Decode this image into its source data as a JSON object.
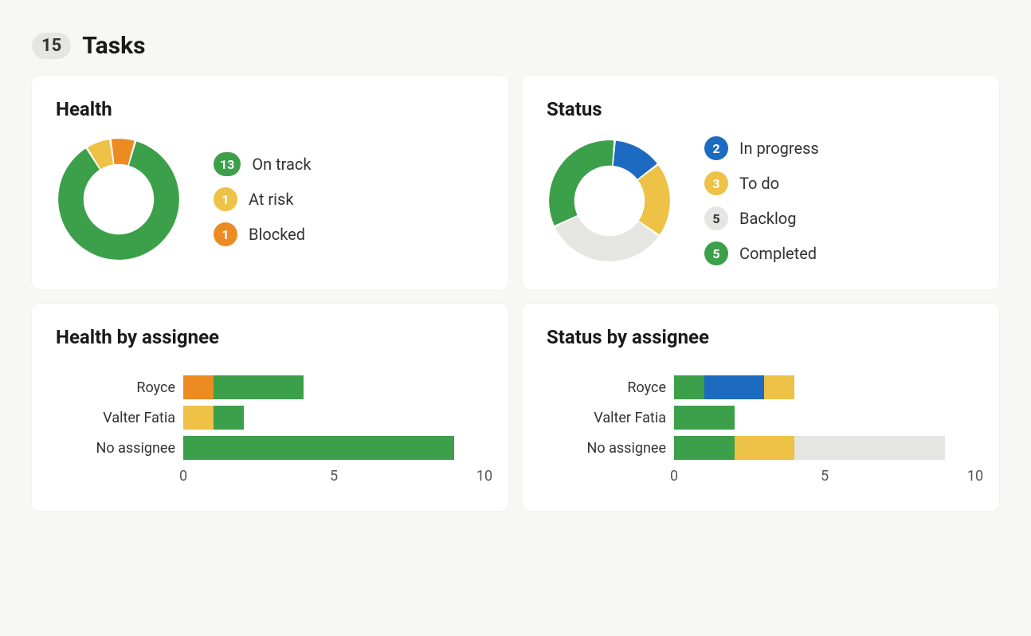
{
  "header": {
    "count": "15",
    "title": "Tasks"
  },
  "colors": {
    "green": "#3c9f4a",
    "yellow": "#eec147",
    "orange": "#ec8b22",
    "blue": "#1d6bc0",
    "grey": "#e5e5e1",
    "dark": "#333333"
  },
  "cards": {
    "health": {
      "title": "Health",
      "items": [
        {
          "value": 13,
          "label": "On track",
          "colorKey": "green"
        },
        {
          "value": 1,
          "label": "At risk",
          "colorKey": "yellow"
        },
        {
          "value": 1,
          "label": "Blocked",
          "colorKey": "orange"
        }
      ]
    },
    "status": {
      "title": "Status",
      "items": [
        {
          "value": 2,
          "label": "In progress",
          "colorKey": "blue"
        },
        {
          "value": 3,
          "label": "To do",
          "colorKey": "yellow"
        },
        {
          "value": 5,
          "label": "Backlog",
          "colorKey": "grey",
          "textColorKey": "dark"
        },
        {
          "value": 5,
          "label": "Completed",
          "colorKey": "green"
        }
      ]
    },
    "health_by_assignee": {
      "title": "Health by assignee",
      "xmax": 10,
      "ticks": [
        0,
        5,
        10
      ],
      "rows": [
        {
          "label": "Royce",
          "segments": [
            {
              "value": 1,
              "colorKey": "orange"
            },
            {
              "value": 3,
              "colorKey": "green"
            }
          ]
        },
        {
          "label": "Valter Fatia",
          "segments": [
            {
              "value": 1,
              "colorKey": "yellow"
            },
            {
              "value": 1,
              "colorKey": "green"
            }
          ]
        },
        {
          "label": "No assignee",
          "segments": [
            {
              "value": 9,
              "colorKey": "green"
            }
          ]
        }
      ]
    },
    "status_by_assignee": {
      "title": "Status by assignee",
      "xmax": 10,
      "ticks": [
        0,
        5,
        10
      ],
      "rows": [
        {
          "label": "Royce",
          "segments": [
            {
              "value": 1,
              "colorKey": "green"
            },
            {
              "value": 2,
              "colorKey": "blue"
            },
            {
              "value": 1,
              "colorKey": "yellow"
            }
          ]
        },
        {
          "label": "Valter Fatia",
          "segments": [
            {
              "value": 2,
              "colorKey": "green"
            }
          ]
        },
        {
          "label": "No assignee",
          "segments": [
            {
              "value": 2,
              "colorKey": "green"
            },
            {
              "value": 2,
              "colorKey": "yellow"
            },
            {
              "value": 5,
              "colorKey": "grey"
            }
          ]
        }
      ]
    }
  },
  "chart_data": [
    {
      "type": "pie",
      "title": "Health",
      "series": [
        {
          "name": "On track",
          "value": 13
        },
        {
          "name": "At risk",
          "value": 1
        },
        {
          "name": "Blocked",
          "value": 1
        }
      ]
    },
    {
      "type": "pie",
      "title": "Status",
      "series": [
        {
          "name": "In progress",
          "value": 2
        },
        {
          "name": "To do",
          "value": 3
        },
        {
          "name": "Backlog",
          "value": 5
        },
        {
          "name": "Completed",
          "value": 5
        }
      ]
    },
    {
      "type": "bar",
      "title": "Health by assignee",
      "categories": [
        "Royce",
        "Valter Fatia",
        "No assignee"
      ],
      "series": [
        {
          "name": "Blocked",
          "values": [
            1,
            0,
            0
          ]
        },
        {
          "name": "At risk",
          "values": [
            0,
            1,
            0
          ]
        },
        {
          "name": "On track",
          "values": [
            3,
            1,
            9
          ]
        }
      ],
      "xlabel": "",
      "ylabel": "",
      "xlim": [
        0,
        10
      ]
    },
    {
      "type": "bar",
      "title": "Status by assignee",
      "categories": [
        "Royce",
        "Valter Fatia",
        "No assignee"
      ],
      "series": [
        {
          "name": "Completed",
          "values": [
            1,
            2,
            2
          ]
        },
        {
          "name": "In progress",
          "values": [
            2,
            0,
            0
          ]
        },
        {
          "name": "To do",
          "values": [
            1,
            0,
            2
          ]
        },
        {
          "name": "Backlog",
          "values": [
            0,
            0,
            5
          ]
        }
      ],
      "xlabel": "",
      "ylabel": "",
      "xlim": [
        0,
        10
      ]
    }
  ]
}
